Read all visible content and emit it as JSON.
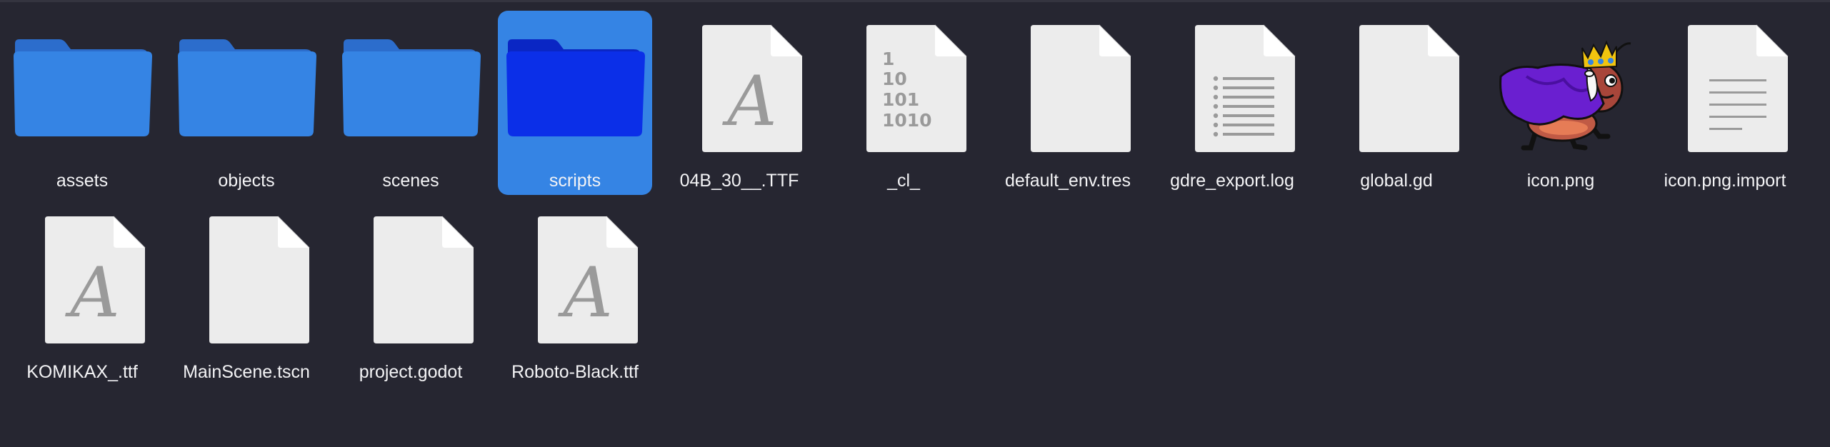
{
  "files": [
    {
      "name": "assets",
      "icon": "folder-icon"
    },
    {
      "name": "objects",
      "icon": "folder-icon"
    },
    {
      "name": "scenes",
      "icon": "folder-icon"
    },
    {
      "name": "scripts",
      "icon": "folder-icon",
      "selected": true
    },
    {
      "name": "04B_30__.TTF",
      "icon": "font-file-icon"
    },
    {
      "name": "_cl_",
      "icon": "binary-file-icon",
      "binary_text": [
        "1",
        "10",
        "101",
        "1010"
      ]
    },
    {
      "name": "default_env.tres",
      "icon": "blank-file-icon"
    },
    {
      "name": "gdre_export.log",
      "icon": "text-list-file-icon"
    },
    {
      "name": "global.gd",
      "icon": "blank-file-icon"
    },
    {
      "name": "icon.png",
      "icon": "beetle-king-image-icon"
    },
    {
      "name": "icon.png.import",
      "icon": "text-file-icon"
    },
    {
      "name": "KOMIKAX_.ttf",
      "icon": "font-file-icon"
    },
    {
      "name": "MainScene.tscn",
      "icon": "blank-file-icon"
    },
    {
      "name": "project.godot",
      "icon": "blank-file-icon"
    },
    {
      "name": "Roboto-Black.ttf",
      "icon": "font-file-icon"
    }
  ],
  "font_glyph": "A",
  "colors": {
    "background": "#262631",
    "folder": "#3584e4",
    "folder_back": "#2c6dcc",
    "selected_bg": "#3584e4",
    "selected_folder": "#0b2fe8",
    "file_page": "#ececec",
    "file_glyph": "#9a9a9a"
  }
}
